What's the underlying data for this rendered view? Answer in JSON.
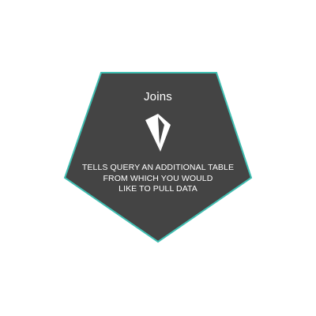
{
  "card": {
    "title": "Joins",
    "icon": "diamond-gem-icon",
    "description_lines": [
      "TELLS  QUERY AN ADDITIONAL TABLE",
      "FROM WHICH YOU WOULD",
      "LIKE TO PULL DATA"
    ]
  },
  "colors": {
    "background": "#ffffff",
    "pentagon_fill": "#444444",
    "pentagon_stroke": "#3fbfb2",
    "text": "#ffffff"
  }
}
